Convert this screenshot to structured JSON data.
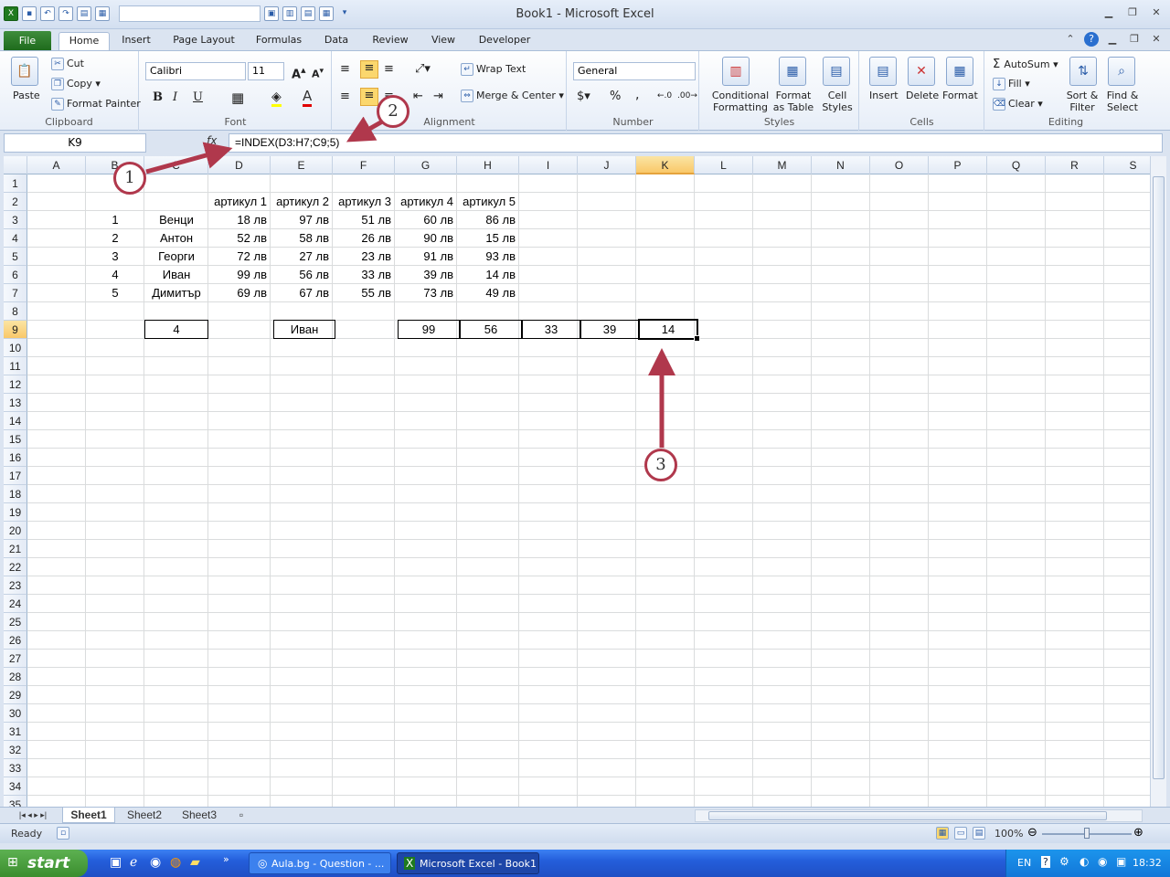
{
  "window": {
    "title": "Book1  -  Microsoft Excel"
  },
  "tabs": [
    "File",
    "Home",
    "Insert",
    "Page Layout",
    "Formulas",
    "Data",
    "Review",
    "View",
    "Developer"
  ],
  "ribbon": {
    "clipboard": {
      "label": "Clipboard",
      "paste": "Paste",
      "cut": "Cut",
      "copy": "Copy",
      "format_painter": "Format Painter"
    },
    "font": {
      "label": "Font",
      "name": "Calibri",
      "size": "11",
      "bold": "B",
      "italic": "I",
      "underline": "U"
    },
    "alignment": {
      "label": "Alignment",
      "wrap": "Wrap Text",
      "merge": "Merge & Center"
    },
    "number": {
      "label": "Number",
      "format": "General",
      "percent": "%",
      "comma": ","
    },
    "styles": {
      "label": "Styles",
      "conditional": "Conditional Formatting",
      "format_table": "Format as Table",
      "cell_styles": "Cell Styles"
    },
    "cells": {
      "label": "Cells",
      "insert": "Insert",
      "delete": "Delete",
      "format": "Format"
    },
    "editing": {
      "label": "Editing",
      "autosum": "AutoSum",
      "fill": "Fill",
      "clear": "Clear",
      "sort": "Sort & Filter",
      "find": "Find & Select"
    }
  },
  "formula_bar": {
    "name_box": "K9",
    "fx": "fx",
    "formula": "=INDEX(D3:H7;C9;5)"
  },
  "columns": [
    "A",
    "B",
    "C",
    "D",
    "E",
    "F",
    "G",
    "H",
    "I",
    "J",
    "K",
    "L",
    "M",
    "N",
    "O",
    "P",
    "Q",
    "R",
    "S"
  ],
  "rows": [
    "1",
    "2",
    "3",
    "4",
    "5",
    "6",
    "7",
    "8",
    "9",
    "10",
    "11",
    "12",
    "13",
    "14",
    "15",
    "16",
    "17",
    "18",
    "19",
    "20",
    "21",
    "22",
    "23",
    "24",
    "25",
    "26",
    "27",
    "28",
    "29",
    "30",
    "31",
    "32",
    "33",
    "34",
    "35"
  ],
  "selected": {
    "column": "K",
    "row": "9"
  },
  "table": {
    "headers": [
      "артикул 1",
      "артикул 2",
      "артикул 3",
      "артикул 4",
      "артикул 5"
    ],
    "rows": [
      {
        "num": "1",
        "name": "Венци",
        "values": [
          "18 лв",
          "97 лв",
          "51 лв",
          "60 лв",
          "86 лв"
        ]
      },
      {
        "num": "2",
        "name": "Антон",
        "values": [
          "52 лв",
          "58 лв",
          "26 лв",
          "90 лв",
          "15 лв"
        ]
      },
      {
        "num": "3",
        "name": "Георги",
        "values": [
          "72 лв",
          "27 лв",
          "23 лв",
          "91 лв",
          "93 лв"
        ]
      },
      {
        "num": "4",
        "name": "Иван",
        "values": [
          "99 лв",
          "56 лв",
          "33 лв",
          "39 лв",
          "14 лв"
        ]
      },
      {
        "num": "5",
        "name": "Димитър",
        "values": [
          "69 лв",
          "67 лв",
          "55 лв",
          "73 лв",
          "49 лв"
        ]
      }
    ]
  },
  "row9": {
    "c9": "4",
    "e9": "Иван",
    "g9": "99",
    "h9": "56",
    "i9": "33",
    "j9": "39",
    "k9": "14"
  },
  "sheets": [
    "Sheet1",
    "Sheet2",
    "Sheet3"
  ],
  "status": {
    "ready": "Ready",
    "zoom": "100%"
  },
  "taskbar": {
    "start": "start",
    "btn1": "Aula.bg - Question - ...",
    "btn2": "Microsoft Excel - Book1",
    "lang": "EN",
    "clock": "18:32"
  },
  "annotations": [
    "1",
    "2",
    "3"
  ],
  "colors": {
    "accent": "#b0384c",
    "file_tab": "#2e7d2b",
    "selection": "#f9c869"
  }
}
